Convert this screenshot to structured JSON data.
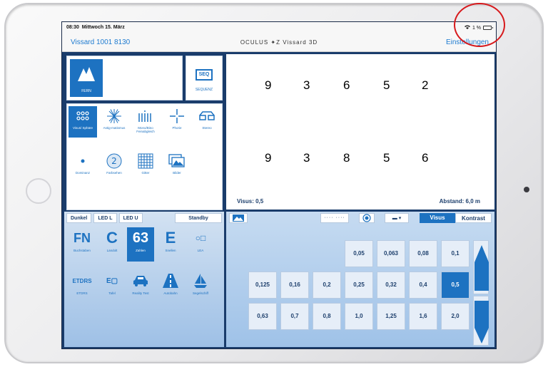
{
  "status": {
    "time": "08:30",
    "date": "Mittwoch 15. März",
    "battery": "1 %"
  },
  "nav": {
    "device": "Vissard 1001 8130",
    "brand": "OCULUS ✦Z Vissard 3D",
    "settings": "Einstellungen"
  },
  "modes": {
    "fern": "FERN",
    "seq_icon": "SEQ",
    "seq_label": "SEQUENZ"
  },
  "tests": [
    {
      "label": "Visus/ Sphäre",
      "icon": "dots-grid-icon",
      "active": true
    },
    {
      "label": "Astig-matismus",
      "icon": "star-lines-icon",
      "active": false
    },
    {
      "label": "Mono/Bino Feinabgleich",
      "icon": "bars-icon",
      "active": false
    },
    {
      "label": "Phorie",
      "icon": "cross-icon",
      "active": false
    },
    {
      "label": "Stereo",
      "icon": "glasses-icon",
      "active": false
    },
    {
      "label": "Dominanz",
      "icon": "dot-icon",
      "active": false
    },
    {
      "label": "Farbsehen",
      "icon": "color-plate-icon",
      "active": false
    },
    {
      "label": "Gitter",
      "icon": "grid-icon",
      "active": false
    },
    {
      "label": "Bilder",
      "icon": "images-icon",
      "active": false
    }
  ],
  "display": {
    "row1": [
      "9",
      "3",
      "6",
      "5",
      "2"
    ],
    "row2": [
      "9",
      "3",
      "8",
      "5",
      "6"
    ],
    "visus": "Visus: 0,5",
    "abstand": "Abstand: 6,0 m"
  },
  "light_tabs": [
    "Dunkel",
    "LED L",
    "LED U"
  ],
  "standby": "Standby",
  "optotypes": [
    {
      "glyph": "FN",
      "label": "Buchstaben",
      "active": false
    },
    {
      "glyph": "C",
      "label": "Landolt",
      "active": false
    },
    {
      "glyph": "63",
      "label": "Zahlen",
      "active": true
    },
    {
      "glyph": "E",
      "label": "Snellen",
      "active": false
    },
    {
      "glyph": "○□",
      "label": "LEA",
      "active": false
    },
    {
      "glyph": "ETDRS",
      "label": "ETDRS",
      "active": false
    },
    {
      "glyph": "E▢",
      "label": "Tafel",
      "active": false
    },
    {
      "glyph": "car",
      "label": "Reality Test",
      "active": false
    },
    {
      "glyph": "road",
      "label": "Autobahn",
      "active": false
    },
    {
      "glyph": "boat",
      "label": "Segelschiff",
      "active": false
    }
  ],
  "toolbar": {
    "dots": "···· ····",
    "line": "▬ ▾",
    "visus": "Visus",
    "kontrast": "Kontrast"
  },
  "acuity": {
    "row1": [
      "0,05",
      "0,063",
      "0,08",
      "0,1"
    ],
    "row2": [
      "0,125",
      "0,16",
      "0,2",
      "0,25",
      "0,32",
      "0,4",
      "0,5"
    ],
    "row3": [
      "0,63",
      "0,7",
      "0,8",
      "1,0",
      "1,25",
      "1,6",
      "2,0"
    ],
    "selected": "0,5"
  },
  "colors": {
    "accent": "#1d72c1",
    "annotation": "#d7191c"
  }
}
